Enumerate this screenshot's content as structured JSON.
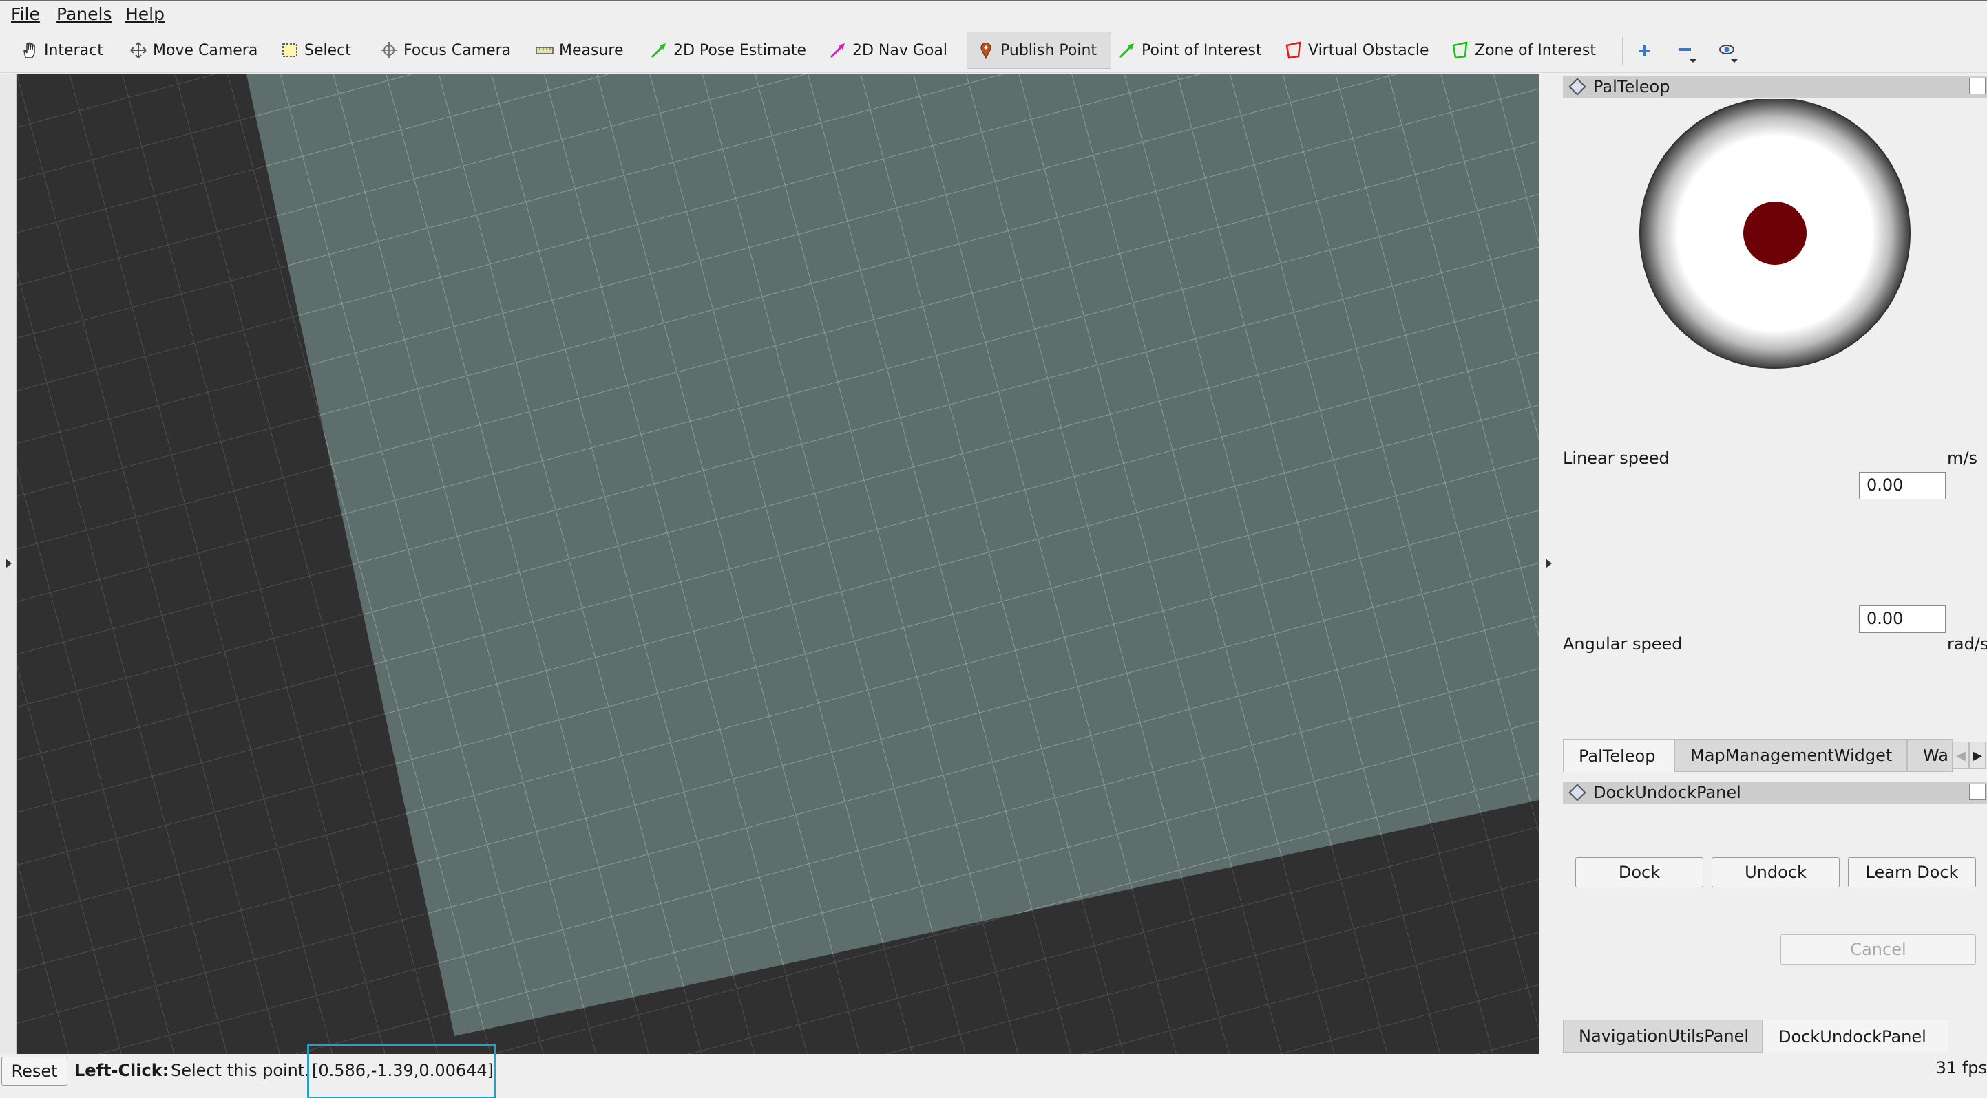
{
  "menu": [
    "File",
    "Panels",
    "Help"
  ],
  "toolbar": {
    "tools": [
      {
        "label": "Interact",
        "icon": "hand-icon"
      },
      {
        "label": "Move Camera",
        "icon": "move-camera-icon"
      },
      {
        "label": "Select",
        "icon": "select-box-icon"
      },
      {
        "label": "Focus Camera",
        "icon": "focus-camera-icon"
      },
      {
        "label": "Measure",
        "icon": "ruler-icon"
      },
      {
        "label": "2D Pose Estimate",
        "icon": "green-arrow-icon"
      },
      {
        "label": "2D Nav Goal",
        "icon": "magenta-arrow-icon"
      },
      {
        "label": "Publish Point",
        "icon": "map-pin-icon"
      },
      {
        "label": "Point of Interest",
        "icon": "green-arrow-icon"
      },
      {
        "label": "Virtual Obstacle",
        "icon": "red-polygon-icon"
      },
      {
        "label": "Zone of Interest",
        "icon": "green-polygon-icon"
      }
    ],
    "active_tool": "Publish Point"
  },
  "pal_teleop": {
    "title": "PalTeleop",
    "linear_label": "Linear speed",
    "linear_unit": "m/s",
    "linear_value": "0.00",
    "angular_label": "Angular speed",
    "angular_unit": "rad/s",
    "angular_value": "0.00"
  },
  "top_tabs": [
    "PalTeleop",
    "MapManagementWidget",
    "Wa"
  ],
  "dock_panel": {
    "title": "DockUndockPanel",
    "buttons": [
      "Dock",
      "Undock",
      "Learn Dock"
    ],
    "cancel": "Cancel"
  },
  "bottom_tabs": [
    "NavigationUtilsPanel",
    "DockUndockPanel"
  ],
  "status": {
    "reset": "Reset",
    "hint_bold": "Left-Click:",
    "hint_text": "Select this point.",
    "coords": "[0.586,-1.39,0.00644]",
    "fps": "31 fps"
  },
  "colors": {
    "grid_plane": "#5d6e6c",
    "background": "#303030",
    "joystick_knob": "#6e0008",
    "highlight_box": "#2a9fc0"
  }
}
